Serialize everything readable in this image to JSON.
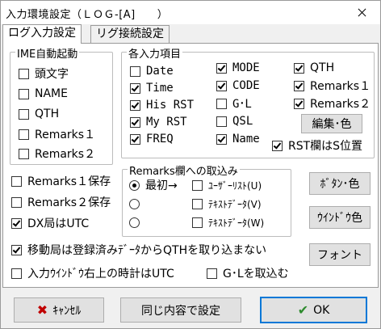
{
  "window": {
    "title": "入力環境設定（ＬＯＧ-[A]　　）"
  },
  "tabs": [
    {
      "label": "ログ入力設定"
    },
    {
      "label": "リグ接続設定"
    }
  ],
  "ime_group": {
    "legend": "IME自動起動",
    "items": [
      {
        "label": "頭文字",
        "checked": false
      },
      {
        "label": "NAME",
        "checked": false
      },
      {
        "label": "QTH",
        "checked": false
      },
      {
        "label": "Remarks１",
        "checked": false
      },
      {
        "label": "Remarks２",
        "checked": false
      }
    ]
  },
  "fields_group": {
    "legend": "各入力項目",
    "col1": [
      {
        "label": "Date",
        "checked": false
      },
      {
        "label": "Time",
        "checked": true
      },
      {
        "label": "His RST",
        "checked": true
      },
      {
        "label": "My RST",
        "checked": true
      },
      {
        "label": "FREQ",
        "checked": true
      }
    ],
    "col2": [
      {
        "label": "MODE",
        "checked": true
      },
      {
        "label": "CODE",
        "checked": true
      },
      {
        "label": "G･L",
        "checked": false
      },
      {
        "label": "QSL",
        "checked": false
      },
      {
        "label": "Name",
        "checked": true
      }
    ],
    "col3": [
      {
        "label": "QTH",
        "checked": true
      },
      {
        "label": "Remarks１",
        "checked": true
      },
      {
        "label": "Remarks２",
        "checked": true
      }
    ],
    "edit_color_button": "編集･色",
    "rst_option": {
      "label": "RST欄はS位置",
      "checked": true
    }
  },
  "left_options": [
    {
      "label": "Remarks１保存",
      "checked": false
    },
    {
      "label": "Remarks２保存",
      "checked": false
    },
    {
      "label": "DX局はUTC",
      "checked": true
    }
  ],
  "remarks_group": {
    "legend": "Remarks欄への取込み",
    "rows": [
      {
        "radio_label": "最初→",
        "selected": true,
        "check_label": "ﾕｰｻﾞｰﾘｽﾄ(U)"
      },
      {
        "radio_label": "",
        "selected": false,
        "check_label": "ﾃｷｽﾄﾃﾞｰﾀ(V)"
      },
      {
        "radio_label": "",
        "selected": false,
        "check_label": "ﾃｷｽﾄﾃﾞｰﾀ(W)"
      }
    ]
  },
  "side_buttons": {
    "button_color": "ﾎﾞﾀﾝ･色",
    "window_color": "ｳｲﾝﾄﾞｳ色",
    "font": "フォント"
  },
  "bottom_options": {
    "mobile": {
      "label": "移動局は登録済みﾃﾞｰﾀからQTHを取り込まない",
      "checked": true
    },
    "clock": {
      "label": "入力ｳｲﾝﾄﾞｳ右上の時計はUTC",
      "checked": false
    },
    "gl": {
      "label": "G･Lを取込む",
      "checked": false
    }
  },
  "footer": {
    "cancel": "ｷｬﾝｾﾙ",
    "same": "同じ内容で設定",
    "ok": "OK"
  },
  "icons": {
    "cancel_color": "#c00000",
    "ok_color": "#2e8b2e"
  }
}
